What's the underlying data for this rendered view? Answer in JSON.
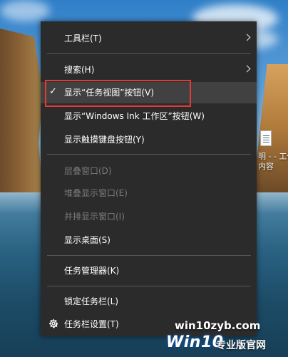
{
  "context_menu": {
    "items": [
      {
        "label": "工具栏(T)",
        "has_submenu": true,
        "disabled": false
      },
      {
        "label": "搜索(H)",
        "has_submenu": true,
        "disabled": false
      },
      {
        "label": "显示“任务视图”按钮(V)",
        "checked": true,
        "disabled": false
      },
      {
        "label": "显示“Windows Ink 工作区”按钮(W)",
        "disabled": false
      },
      {
        "label": "显示触摸键盘按钮(Y)",
        "disabled": false
      },
      {
        "label": "层叠窗口(D)",
        "disabled": true
      },
      {
        "label": "堆叠显示窗口(E)",
        "disabled": true
      },
      {
        "label": "并排显示窗口(I)",
        "disabled": true
      },
      {
        "label": "显示桌面(S)",
        "disabled": false
      },
      {
        "label": "任务管理器(K)",
        "disabled": false
      },
      {
        "label": "锁定任务栏(L)",
        "disabled": false
      },
      {
        "label": "任务栏设置(T)",
        "icon": "gear-icon",
        "disabled": false
      }
    ]
  },
  "desktop": {
    "icon_label_line1": "明 - - 工作",
    "icon_label_line2": "内容"
  },
  "watermark": {
    "site": "win10zyb.com",
    "logo_text": "Win10",
    "logo_subtitle": "专业版官网"
  },
  "colors": {
    "menu_bg": "#2b2b2b",
    "highlight_border": "#e53935",
    "disabled_text": "#7b7b7b"
  }
}
